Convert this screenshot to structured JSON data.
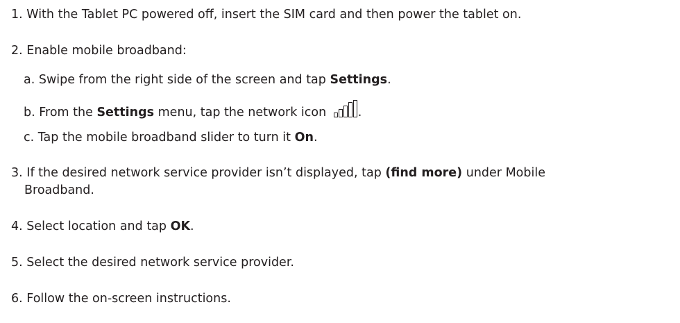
{
  "steps": [
    {
      "number": "1.",
      "text": "With the Tablet PC powered off, insert the SIM card and then power the tablet on."
    },
    {
      "number": "2.",
      "text": "Enable mobile broadband:",
      "substeps": [
        {
          "letter": "a.",
          "before": "Swipe from the right side of the screen and tap ",
          "bold": "Settings",
          "after": "."
        },
        {
          "letter": "b.",
          "before": "From the ",
          "bold": "Settings",
          "after": " menu, tap the network icon",
          "icon": "network-signal-bars-icon",
          "end": "."
        },
        {
          "letter": "c.",
          "before": "Tap the mobile broadband slider to turn it ",
          "bold": "On",
          "after": "."
        }
      ]
    },
    {
      "number": "3.",
      "before": "If the desired network service provider isn’t displayed, tap ",
      "bold": "(find more)",
      "after": " under Mobile",
      "continuation": "Broadband."
    },
    {
      "number": "4.",
      "before": "Select location and tap ",
      "bold": "OK",
      "after": "."
    },
    {
      "number": "5.",
      "text": "Select the desired network service provider."
    },
    {
      "number": "6.",
      "text": "Follow the on-screen instructions."
    }
  ]
}
